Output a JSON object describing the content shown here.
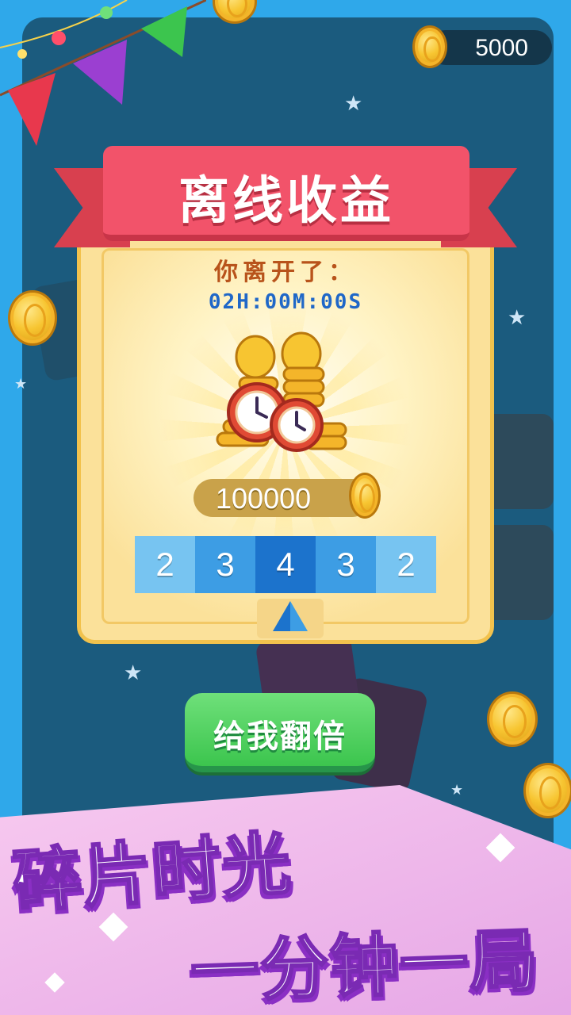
{
  "coin_counter": {
    "value": "5000",
    "icon": "coin-icon"
  },
  "offline_dialog": {
    "title": "离线收益",
    "left_label": "你离开了：",
    "timer": "02H:00M:00S",
    "reward_amount": "100000",
    "multipliers": [
      "2",
      "3",
      "4",
      "3",
      "2"
    ],
    "selected_multiplier_index": 2
  },
  "double_button": {
    "label": "给我翻倍"
  },
  "promo": {
    "line1": "碎片时光",
    "line2": "一分钟一局"
  },
  "colors": {
    "board": "#1b5b7e",
    "ribbon": "#f2536a",
    "panel": "#fbe19a",
    "button_green": "#3cc54e",
    "promo_purple": "#8a2fc4",
    "multiplier_light": "#77c4f1",
    "multiplier_mid": "#3d9de4",
    "multiplier_dark": "#1c73cc"
  }
}
